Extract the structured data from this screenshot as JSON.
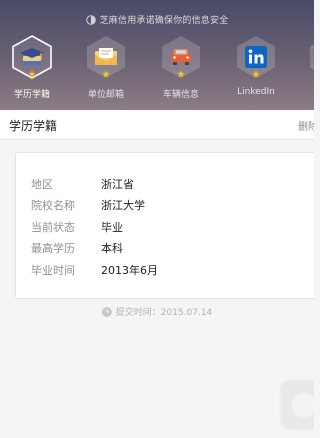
{
  "notice": "芝麻信用承诺确保你的信息安全",
  "categories": [
    {
      "label": "学历学籍",
      "active": true
    },
    {
      "label": "单位邮箱",
      "active": false
    },
    {
      "label": "车辆信息",
      "active": false
    },
    {
      "label": "LinkedIn",
      "active": false
    }
  ],
  "section": {
    "title": "学历学籍",
    "action": "删除"
  },
  "details": [
    {
      "key": "地区",
      "value": "浙江省"
    },
    {
      "key": "院校名称",
      "value": "浙江大学"
    },
    {
      "key": "当前状态",
      "value": "毕业"
    },
    {
      "key": "最高学历",
      "value": "本科"
    },
    {
      "key": "毕业时间",
      "value": "2013年6月"
    }
  ],
  "submit_time": "提交时间：2015.07.14",
  "icons": {
    "notice": "shield-icon",
    "category_0": "graduation-cap-icon",
    "category_1": "envelope-icon",
    "category_2": "car-icon",
    "category_3": "linkedin-icon",
    "submit": "clock-icon"
  },
  "colors": {
    "header_top": "#4a4b67",
    "header_bottom": "#8c7d85",
    "star": "#f0c419",
    "linkedin": "#0a66c2"
  }
}
